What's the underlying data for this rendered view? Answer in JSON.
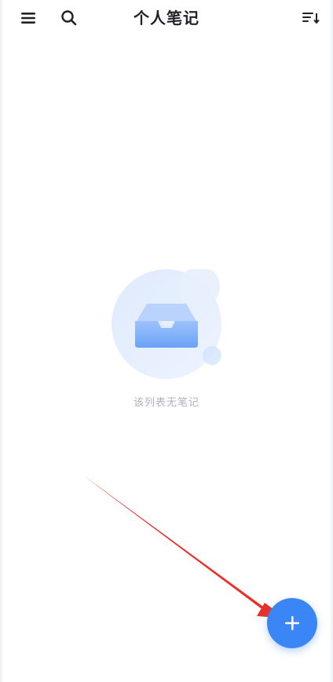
{
  "header": {
    "title": "个人笔记",
    "menu_icon": "menu-icon",
    "search_icon": "search-icon",
    "sort_icon": "sort-icon"
  },
  "empty_state": {
    "illustration": "empty-inbox-icon",
    "message": "该列表无笔记"
  },
  "fab": {
    "icon": "plus-icon"
  },
  "colors": {
    "accent": "#3b86f6",
    "arrow": "#e8302a",
    "title_text": "#1f2329",
    "muted_text": "#aeb4bf"
  }
}
